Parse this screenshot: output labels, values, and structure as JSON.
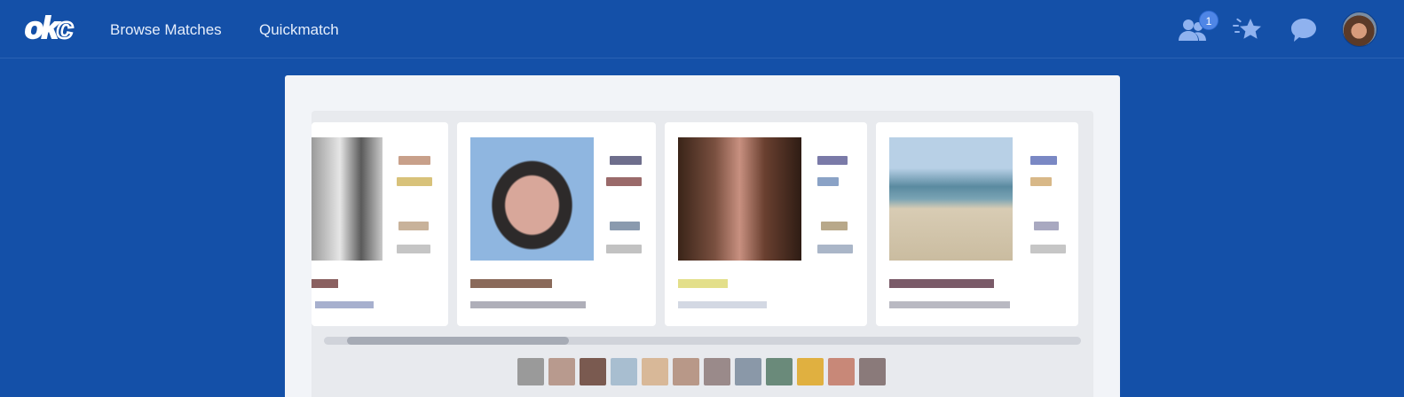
{
  "nav": {
    "logo": "okc",
    "links": [
      "Browse Matches",
      "Quickmatch"
    ],
    "notification_count": "1",
    "icons": [
      "people-icon",
      "star-burst-icon",
      "chat-icon",
      "avatar"
    ]
  },
  "colors": {
    "nav_bg": "#1450a8",
    "icon": "#8fb2ef",
    "panel": "#f2f4f8",
    "carousel": "#e8eaee"
  },
  "carousel": {
    "cards": [
      {
        "id": "card-1",
        "photo": "grayscale-portrait"
      },
      {
        "id": "card-2",
        "photo": "man-with-glasses"
      },
      {
        "id": "card-3",
        "photo": "woman-long-hair"
      },
      {
        "id": "card-4",
        "photo": "beach-scene"
      }
    ],
    "scroll_position": 0.03,
    "thumbnail_count": 12
  }
}
